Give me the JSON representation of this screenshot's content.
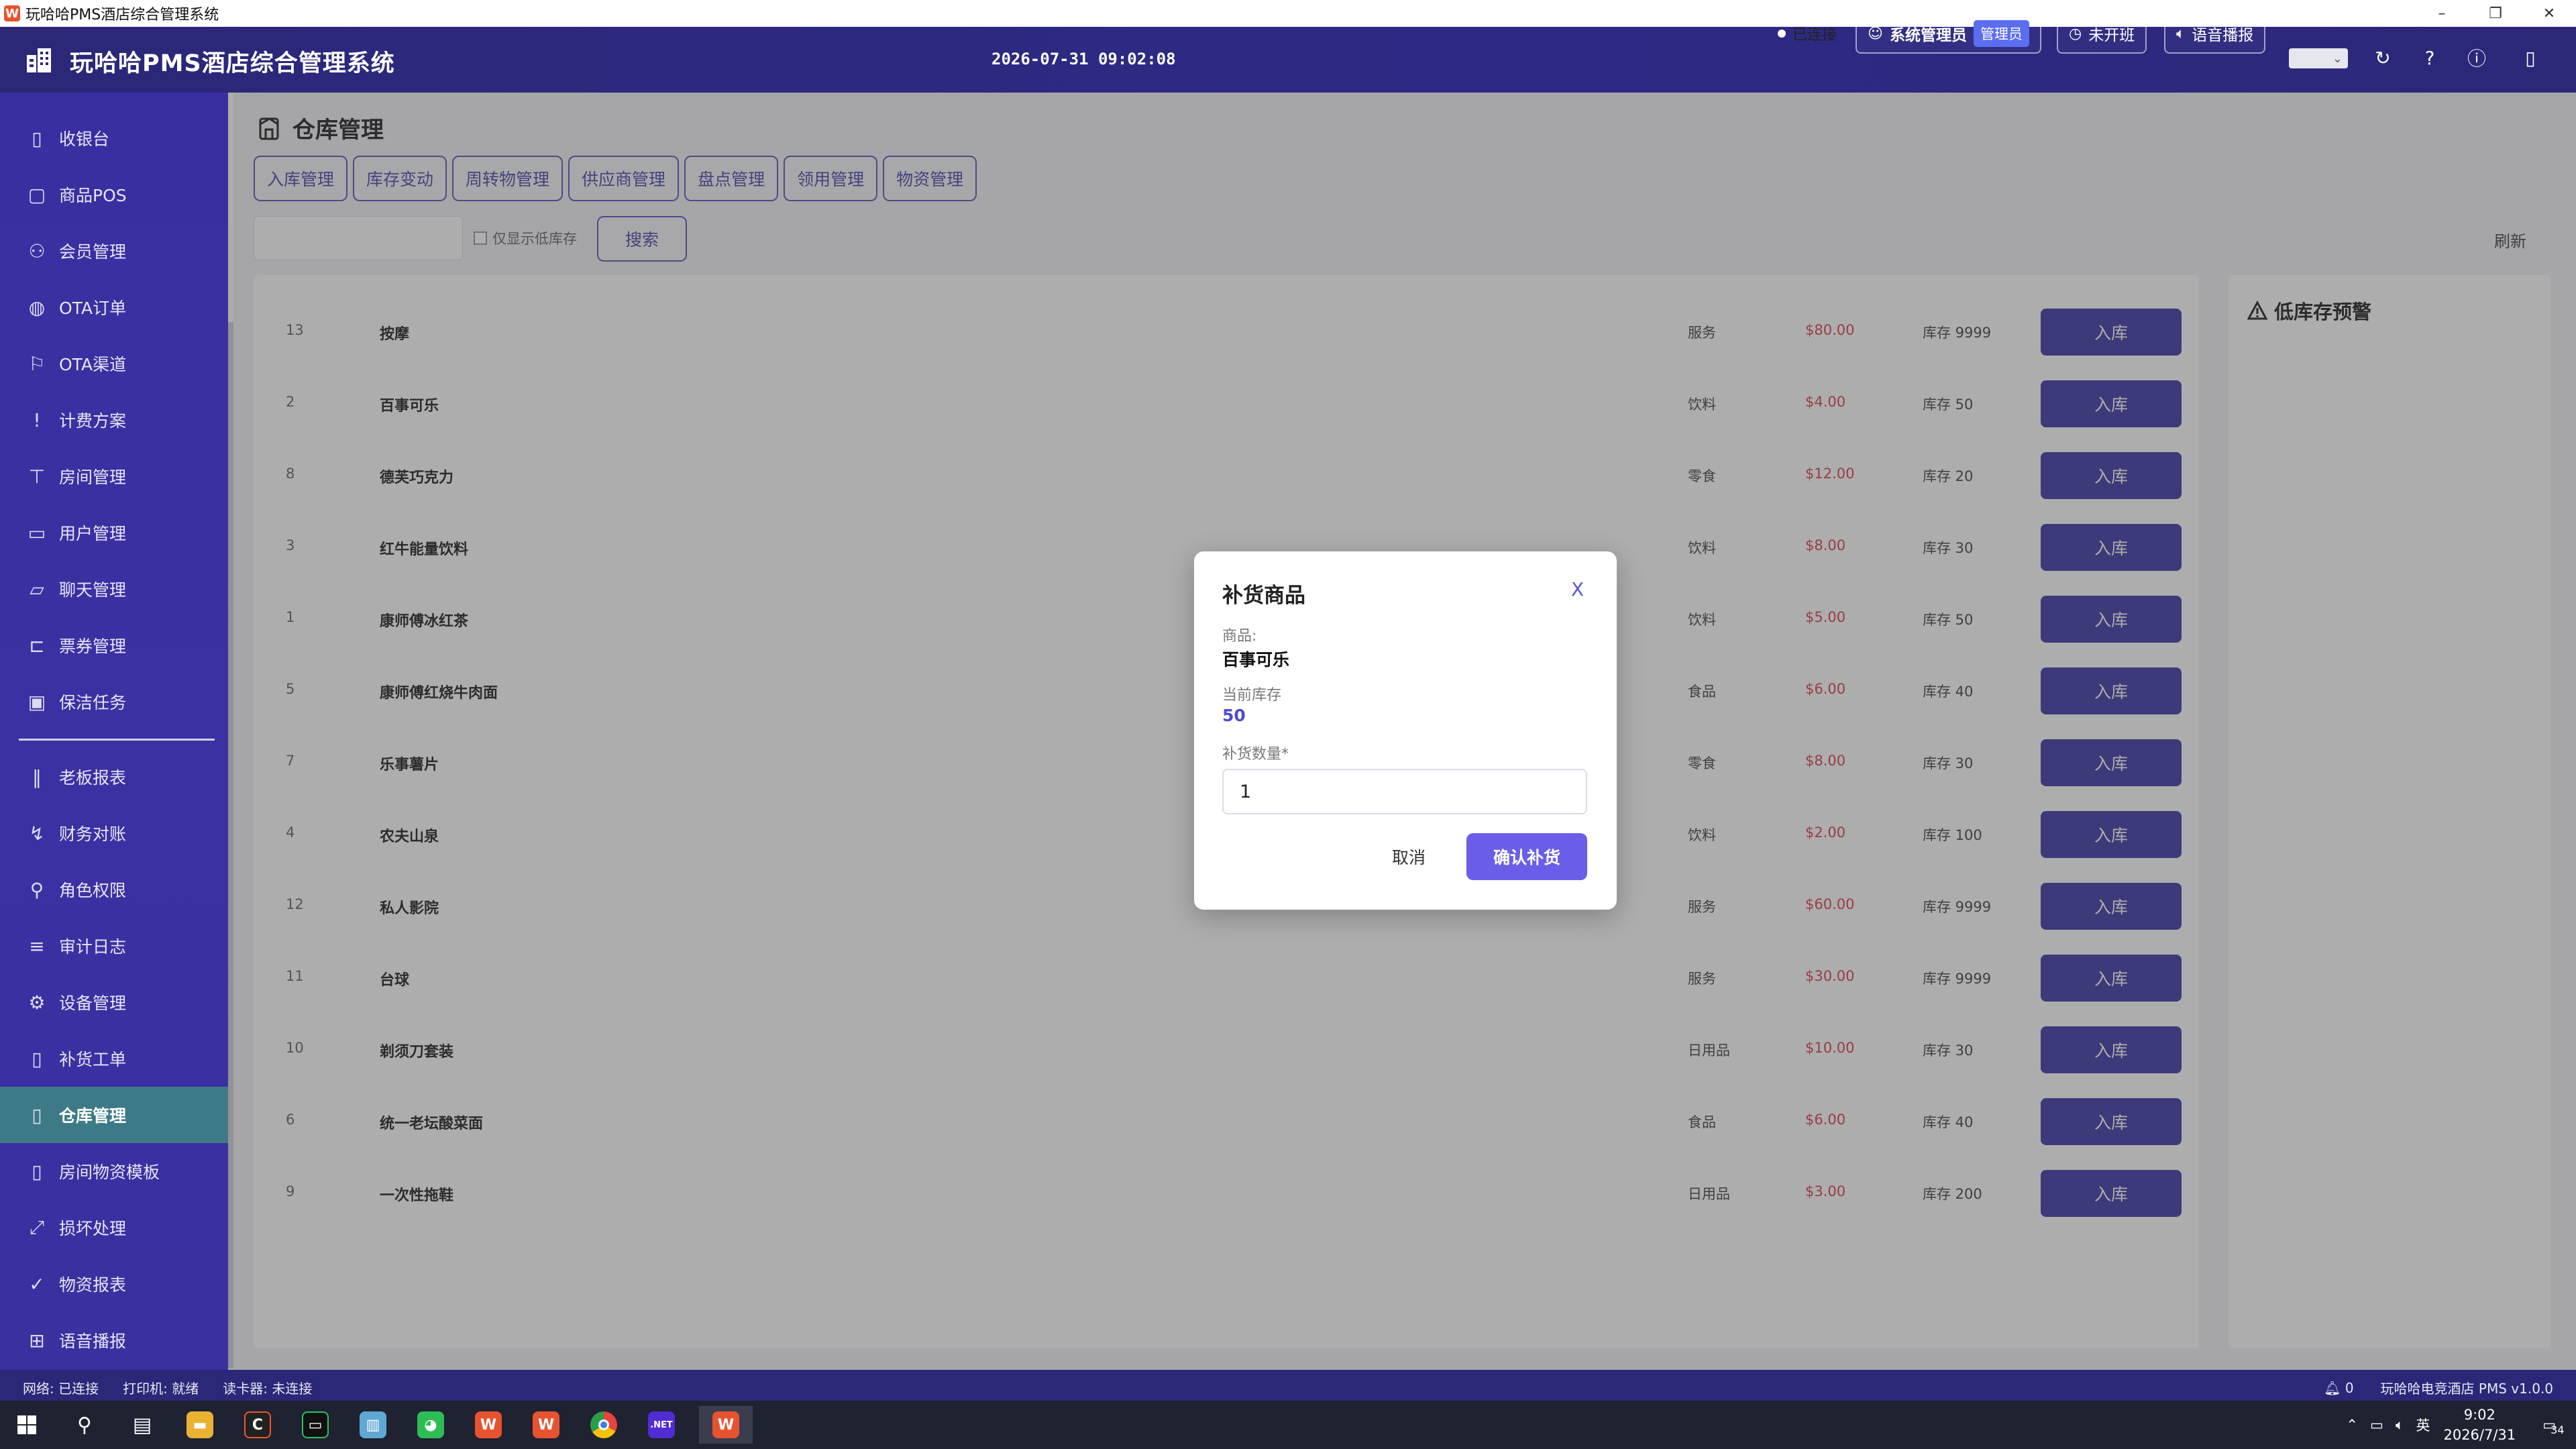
{
  "window": {
    "title": "玩哈哈PMS酒店综合管理系统",
    "controls": [
      "–",
      "❐",
      "✕"
    ]
  },
  "header": {
    "app_title": "玩哈哈PMS酒店综合管理系统",
    "datetime": "2026-07-31 09:02:08",
    "connection": "已连接",
    "user_role": "系统管理员",
    "user_badge": "管理员",
    "shift_button": "未开班",
    "voice_button": "语音播报",
    "icons": [
      "refresh-icon",
      "help-icon",
      "info-icon",
      "mobile-icon"
    ]
  },
  "sidebar": {
    "items": [
      {
        "label": "收银台",
        "icon": "doc-icon",
        "glyph": "▯"
      },
      {
        "label": "商品POS",
        "icon": "bag-icon",
        "glyph": "▢"
      },
      {
        "label": "会员管理",
        "icon": "members-icon",
        "glyph": "⚇"
      },
      {
        "label": "OTA订单",
        "icon": "globe-icon",
        "glyph": "◍"
      },
      {
        "label": "OTA渠道",
        "icon": "flag-icon",
        "glyph": "⚐"
      },
      {
        "label": "计费方案",
        "icon": "exclamation-icon",
        "glyph": "!"
      },
      {
        "label": "房间管理",
        "icon": "sign-icon",
        "glyph": "⊤"
      },
      {
        "label": "用户管理",
        "icon": "user-card-icon",
        "glyph": "▭"
      },
      {
        "label": "聊天管理",
        "icon": "chat-icon",
        "glyph": "▱"
      },
      {
        "label": "票券管理",
        "icon": "ticket-icon",
        "glyph": "⊏"
      },
      {
        "label": "保洁任务",
        "icon": "chip-icon",
        "glyph": "▣"
      },
      {
        "label": "老板报表",
        "icon": "pause-icon",
        "glyph": "‖"
      },
      {
        "label": "财务对账",
        "icon": "flash-icon",
        "glyph": "↯"
      },
      {
        "label": "角色权限",
        "icon": "key-icon",
        "glyph": "⚲"
      },
      {
        "label": "审计日志",
        "icon": "list-icon",
        "glyph": "≡"
      },
      {
        "label": "设备管理",
        "icon": "gear-icon",
        "glyph": "⚙"
      },
      {
        "label": "补货工单",
        "icon": "square-icon",
        "glyph": "▯"
      },
      {
        "label": "仓库管理",
        "icon": "square-icon",
        "glyph": "▯",
        "active": true
      },
      {
        "label": "房间物资模板",
        "icon": "square-icon",
        "glyph": "▯"
      },
      {
        "label": "损坏处理",
        "icon": "resize-icon",
        "glyph": "⤢"
      },
      {
        "label": "物资报表",
        "icon": "check-icon",
        "glyph": "✓"
      },
      {
        "label": "语音播报",
        "icon": "grid-icon",
        "glyph": "⊞"
      }
    ]
  },
  "page": {
    "title": "仓库管理",
    "tabs": [
      "入库管理",
      "库存变动",
      "周转物管理",
      "供应商管理",
      "盘点管理",
      "领用管理",
      "物资管理"
    ],
    "search_placeholder": "",
    "low_stock_checkbox": "仅显示低库存",
    "search_button": "搜索",
    "refresh": "刷新",
    "low_stock_panel_title": "低库存预警"
  },
  "products": [
    {
      "id": "13",
      "name": "按摩",
      "category": "服务",
      "price": "$80.00",
      "stock": "库存 9999",
      "action": "入库"
    },
    {
      "id": "2",
      "name": "百事可乐",
      "category": "饮料",
      "price": "$4.00",
      "stock": "库存 50",
      "action": "入库"
    },
    {
      "id": "8",
      "name": "德芙巧克力",
      "category": "零食",
      "price": "$12.00",
      "stock": "库存 20",
      "action": "入库"
    },
    {
      "id": "3",
      "name": "红牛能量饮料",
      "category": "饮料",
      "price": "$8.00",
      "stock": "库存 30",
      "action": "入库"
    },
    {
      "id": "1",
      "name": "康师傅冰红茶",
      "category": "饮料",
      "price": "$5.00",
      "stock": "库存 50",
      "action": "入库"
    },
    {
      "id": "5",
      "name": "康师傅红烧牛肉面",
      "category": "食品",
      "price": "$6.00",
      "stock": "库存 40",
      "action": "入库"
    },
    {
      "id": "7",
      "name": "乐事薯片",
      "category": "零食",
      "price": "$8.00",
      "stock": "库存 30",
      "action": "入库"
    },
    {
      "id": "4",
      "name": "农夫山泉",
      "category": "饮料",
      "price": "$2.00",
      "stock": "库存 100",
      "action": "入库"
    },
    {
      "id": "12",
      "name": "私人影院",
      "category": "服务",
      "price": "$60.00",
      "stock": "库存 9999",
      "action": "入库"
    },
    {
      "id": "11",
      "name": "台球",
      "category": "服务",
      "price": "$30.00",
      "stock": "库存 9999",
      "action": "入库"
    },
    {
      "id": "10",
      "name": "剃须刀套装",
      "category": "日用品",
      "price": "$10.00",
      "stock": "库存 30",
      "action": "入库"
    },
    {
      "id": "6",
      "name": "统一老坛酸菜面",
      "category": "食品",
      "price": "$6.00",
      "stock": "库存 40",
      "action": "入库"
    },
    {
      "id": "9",
      "name": "一次性拖鞋",
      "category": "日用品",
      "price": "$3.00",
      "stock": "库存 200",
      "action": "入库"
    }
  ],
  "modal": {
    "title": "补货商品",
    "close": "X",
    "product_label": "商品:",
    "product_value": "百事可乐",
    "stock_label": "当前库存",
    "stock_value": "50",
    "qty_label": "补货数量*",
    "qty_value": "1",
    "cancel": "取消",
    "confirm": "确认补货"
  },
  "statusbar": {
    "network": "网络: 已连接",
    "printer": "打印机: 就绪",
    "card_reader": "读卡器: 未连接",
    "notifications": "0",
    "version": "玩哈哈电竞酒店 PMS v1.0.0"
  },
  "taskbar": {
    "time": "9:02",
    "date": "2026/7/31",
    "ime": "英",
    "notify_count": "34"
  },
  "colors": {
    "header_bg": "#2b2878",
    "sidebar_bg": "#3a2fa0",
    "active_item": "#3d7a86",
    "primary_button": "#3d3aa5",
    "confirm_button": "#6a5ee8",
    "price_red": "#d9404a"
  }
}
